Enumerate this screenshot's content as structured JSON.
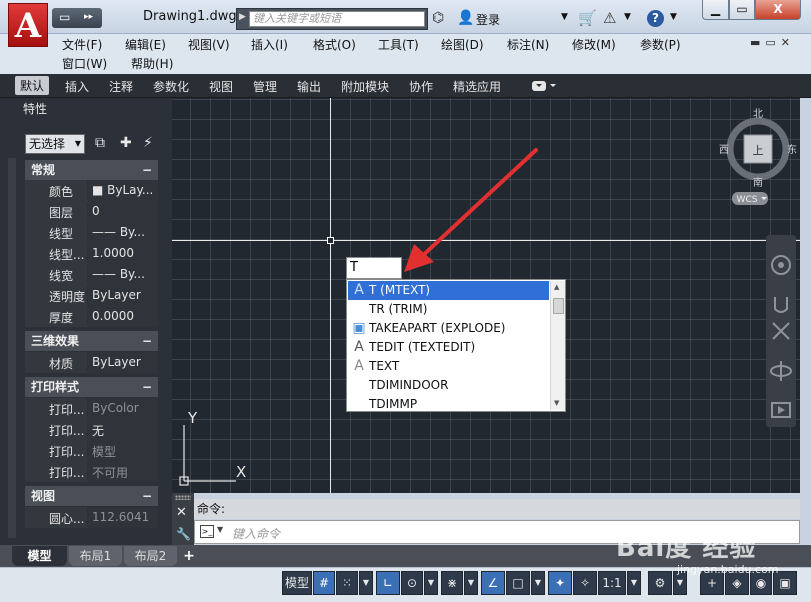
{
  "titlebar": {
    "logo_letter": "A",
    "doc_title": "Drawing1.dwg",
    "search_placeholder": "键入关键字或短语",
    "login_label": "登录",
    "help_label": "?",
    "min_label": "▭",
    "max_label": "▭",
    "close_label": "X"
  },
  "menus": {
    "row1": [
      "文件(F)",
      "编辑(E)",
      "视图(V)",
      "插入(I)",
      "格式(O)",
      "工具(T)",
      "绘图(D)",
      "标注(N)",
      "修改(M)",
      "参数(P)"
    ],
    "row2": [
      "窗口(W)",
      "帮助(H)"
    ]
  },
  "ribbon_tabs": [
    "默认",
    "插入",
    "注释",
    "参数化",
    "视图",
    "管理",
    "输出",
    "附加模块",
    "协作",
    "精选应用"
  ],
  "properties": {
    "title": "特性",
    "selection": "无选择",
    "sections": [
      {
        "title": "常规",
        "rows": [
          {
            "k": "颜色",
            "v": "■ ByLay..."
          },
          {
            "k": "图层",
            "v": "0"
          },
          {
            "k": "线型",
            "v": "—— By..."
          },
          {
            "k": "线型...",
            "v": "1.0000"
          },
          {
            "k": "线宽",
            "v": "—— By..."
          },
          {
            "k": "透明度",
            "v": "ByLayer"
          },
          {
            "k": "厚度",
            "v": "0.0000"
          }
        ]
      },
      {
        "title": "三维效果",
        "rows": [
          {
            "k": "材质",
            "v": "ByLayer"
          }
        ]
      },
      {
        "title": "打印样式",
        "rows": [
          {
            "k": "打印...",
            "v": "ByColor"
          },
          {
            "k": "打印...",
            "v": "无"
          },
          {
            "k": "打印...",
            "v": "模型"
          },
          {
            "k": "打印...",
            "v": "不可用"
          }
        ]
      },
      {
        "title": "视图",
        "rows": [
          {
            "k": "圆心...",
            "v": "112.6041"
          }
        ]
      }
    ]
  },
  "viewcube": {
    "north": "北",
    "south": "南",
    "west": "西",
    "east": "东",
    "top": "上",
    "wcs": "WCS"
  },
  "ucs": {
    "x": "X",
    "y": "Y"
  },
  "dynamic_input": {
    "value": "T"
  },
  "autocomplete": {
    "selected_index": 0,
    "items": [
      {
        "icon": "mtext-icon",
        "glyph": "A",
        "label": "T (MTEXT)"
      },
      {
        "icon": "",
        "glyph": "",
        "label": "TR (TRIM)"
      },
      {
        "icon": "explode-icon",
        "glyph": "▣",
        "label": "TAKEAPART (EXPLODE)"
      },
      {
        "icon": "textedit-icon",
        "glyph": "A",
        "label": "TEDIT (TEXTEDIT)"
      },
      {
        "icon": "text-icon",
        "glyph": "A",
        "label": "TEXT"
      },
      {
        "icon": "",
        "glyph": "",
        "label": "TDIMINDOOR"
      },
      {
        "icon": "",
        "glyph": "",
        "label": "TDIMMP"
      }
    ]
  },
  "command": {
    "history": "命令:",
    "placeholder": "键入命令"
  },
  "layout_tabs": [
    "模型",
    "布局1",
    "布局2"
  ],
  "status": {
    "model": "模型",
    "scale": "1:1"
  },
  "watermark": {
    "brand": "Bai度 经验",
    "sub": "jingyan.baidu.com"
  },
  "colors": {
    "accent": "#2f6fd6",
    "canvas": "#212830",
    "arrow": "#e03030",
    "logo": "#c61e1e"
  }
}
